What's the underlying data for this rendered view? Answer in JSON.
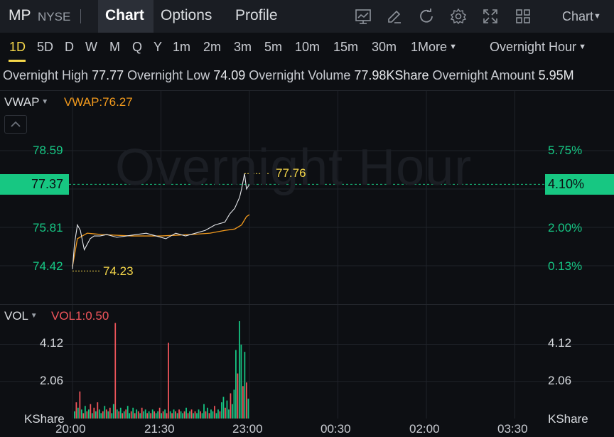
{
  "header": {
    "ticker": "MP",
    "exchange": "NYSE",
    "tabs": [
      {
        "label": "Chart",
        "active": true
      },
      {
        "label": "Options",
        "active": false
      },
      {
        "label": "Profile",
        "active": false
      }
    ],
    "icons": [
      "chart-icon",
      "draw-icon",
      "refresh-icon",
      "settings-icon",
      "fullscreen-icon",
      "grid-icon"
    ],
    "chart_menu": "Chart"
  },
  "timeframes": {
    "items": [
      "1D",
      "5D",
      "D",
      "W",
      "M",
      "Q",
      "Y",
      "1m",
      "2m",
      "3m",
      "5m",
      "10m",
      "15m",
      "30m",
      "1More"
    ],
    "active": "1D",
    "session": "Overnight Hour"
  },
  "info": {
    "high_label": "Overnight High",
    "high": "77.77",
    "low_label": "Overnight Low",
    "low": "74.09",
    "volume_label": "Overnight Volume",
    "volume": "77.98KShare",
    "amount_label": "Overnight Amount",
    "amount": "5.95M"
  },
  "indicators": {
    "main_label": "VWAP",
    "main_value": "VWAP:76.27",
    "sub_label": "VOL",
    "sub_value": "VOL1:0.50"
  },
  "watermark": "Overnight Hour",
  "colors": {
    "up": "#16c784",
    "down": "#f0555b",
    "accent": "#f5d74a",
    "vwap": "#f29a1d"
  },
  "chart_data": {
    "type": "line",
    "x_ticks": [
      "20:00",
      "21:30",
      "23:00",
      "00:30",
      "02:00",
      "03:30"
    ],
    "price_axis_left": [
      "78.59",
      "77.37",
      "75.81",
      "74.42"
    ],
    "price_axis_right": [
      "5.75%",
      "4.10%",
      "2.00%",
      "0.13%"
    ],
    "current_price": "77.37",
    "current_pct": "4.10%",
    "high_marker": "77.76",
    "low_marker": "74.23",
    "ylim": [
      74.0,
      79.0
    ],
    "price_series": {
      "name": "price",
      "times": [
        "20:00",
        "20:02",
        "20:05",
        "20:08",
        "20:12",
        "20:18",
        "20:22",
        "20:28",
        "20:35",
        "20:45",
        "20:55",
        "21:05",
        "21:15",
        "21:25",
        "21:35",
        "21:45",
        "21:55",
        "22:05",
        "22:15",
        "22:25",
        "22:35",
        "22:40",
        "22:45",
        "22:50",
        "22:52",
        "22:55",
        "22:57",
        "23:00"
      ],
      "values": [
        74.3,
        75.2,
        75.9,
        75.7,
        75.0,
        75.4,
        75.5,
        75.5,
        75.55,
        75.45,
        75.5,
        75.55,
        75.6,
        75.5,
        75.4,
        75.6,
        75.5,
        75.6,
        75.7,
        75.9,
        76.0,
        76.3,
        76.5,
        76.9,
        77.2,
        77.76,
        77.2,
        77.37
      ]
    },
    "vwap_series": {
      "name": "VWAP",
      "times": [
        "20:00",
        "20:05",
        "20:15",
        "20:30",
        "21:00",
        "21:30",
        "22:00",
        "22:20",
        "22:35",
        "22:45",
        "22:52",
        "22:57",
        "23:00"
      ],
      "values": [
        74.4,
        75.4,
        75.6,
        75.55,
        75.5,
        75.5,
        75.55,
        75.6,
        75.7,
        75.75,
        75.9,
        76.2,
        76.27
      ]
    },
    "volume_axis": [
      "4.12",
      "2.06"
    ],
    "volume_unit": "KShare",
    "volume_ylim": [
      0,
      5.4
    ],
    "volume_bars": [
      [
        0.4,
        "u"
      ],
      [
        0.9,
        "d"
      ],
      [
        0.6,
        "u"
      ],
      [
        1.5,
        "d"
      ],
      [
        0.5,
        "u"
      ],
      [
        0.3,
        "d"
      ],
      [
        0.7,
        "u"
      ],
      [
        0.4,
        "d"
      ],
      [
        0.5,
        "u"
      ],
      [
        0.8,
        "d"
      ],
      [
        0.3,
        "u"
      ],
      [
        0.6,
        "d"
      ],
      [
        0.4,
        "u"
      ],
      [
        0.9,
        "d"
      ],
      [
        0.5,
        "u"
      ],
      [
        0.3,
        "u"
      ],
      [
        0.4,
        "d"
      ],
      [
        0.7,
        "u"
      ],
      [
        0.5,
        "d"
      ],
      [
        0.4,
        "u"
      ],
      [
        0.6,
        "d"
      ],
      [
        0.3,
        "u"
      ],
      [
        0.8,
        "u"
      ],
      [
        5.3,
        "d"
      ],
      [
        0.5,
        "u"
      ],
      [
        0.4,
        "d"
      ],
      [
        0.6,
        "u"
      ],
      [
        0.3,
        "d"
      ],
      [
        0.4,
        "u"
      ],
      [
        0.5,
        "d"
      ],
      [
        0.7,
        "u"
      ],
      [
        0.3,
        "u"
      ],
      [
        0.4,
        "d"
      ],
      [
        0.6,
        "u"
      ],
      [
        0.3,
        "d"
      ],
      [
        0.5,
        "u"
      ],
      [
        0.4,
        "d"
      ],
      [
        0.3,
        "u"
      ],
      [
        0.6,
        "d"
      ],
      [
        0.4,
        "u"
      ],
      [
        0.5,
        "u"
      ],
      [
        0.3,
        "d"
      ],
      [
        0.4,
        "u"
      ],
      [
        0.3,
        "d"
      ],
      [
        0.5,
        "u"
      ],
      [
        0.4,
        "d"
      ],
      [
        0.3,
        "u"
      ],
      [
        0.4,
        "u"
      ],
      [
        0.6,
        "d"
      ],
      [
        0.3,
        "u"
      ],
      [
        0.4,
        "d"
      ],
      [
        0.5,
        "u"
      ],
      [
        0.3,
        "d"
      ],
      [
        4.2,
        "d"
      ],
      [
        0.4,
        "u"
      ],
      [
        0.3,
        "d"
      ],
      [
        0.5,
        "u"
      ],
      [
        0.4,
        "d"
      ],
      [
        0.3,
        "u"
      ],
      [
        0.5,
        "d"
      ],
      [
        0.4,
        "u"
      ],
      [
        0.3,
        "u"
      ],
      [
        0.4,
        "d"
      ],
      [
        0.6,
        "u"
      ],
      [
        0.3,
        "d"
      ],
      [
        0.4,
        "u"
      ],
      [
        0.5,
        "d"
      ],
      [
        0.3,
        "u"
      ],
      [
        0.4,
        "d"
      ],
      [
        0.3,
        "u"
      ],
      [
        0.5,
        "u"
      ],
      [
        0.4,
        "d"
      ],
      [
        0.3,
        "u"
      ],
      [
        0.8,
        "u"
      ],
      [
        0.4,
        "d"
      ],
      [
        0.6,
        "u"
      ],
      [
        0.3,
        "d"
      ],
      [
        0.5,
        "u"
      ],
      [
        0.4,
        "u"
      ],
      [
        0.7,
        "d"
      ],
      [
        0.3,
        "u"
      ],
      [
        0.5,
        "u"
      ],
      [
        0.4,
        "d"
      ],
      [
        0.9,
        "u"
      ],
      [
        1.2,
        "u"
      ],
      [
        0.6,
        "d"
      ],
      [
        1.0,
        "u"
      ],
      [
        0.5,
        "u"
      ],
      [
        1.4,
        "d"
      ],
      [
        0.8,
        "u"
      ],
      [
        1.6,
        "u"
      ],
      [
        3.8,
        "u"
      ],
      [
        2.5,
        "d"
      ],
      [
        5.4,
        "u"
      ],
      [
        4.1,
        "u"
      ],
      [
        1.8,
        "d"
      ],
      [
        3.7,
        "u"
      ],
      [
        2.0,
        "d"
      ],
      [
        1.1,
        "u"
      ]
    ]
  }
}
